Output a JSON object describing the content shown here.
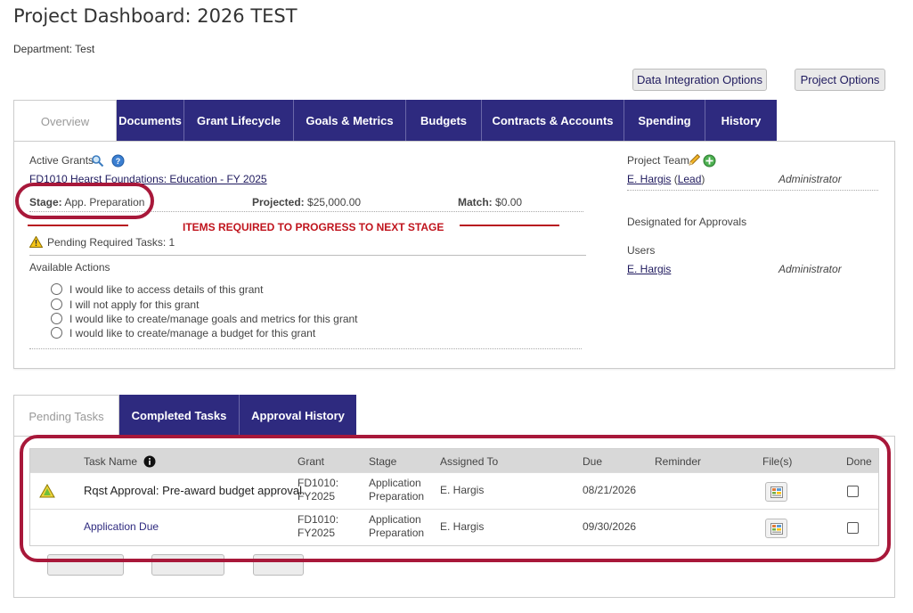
{
  "header": {
    "title": "Project Dashboard: 2026 TEST",
    "department": "Department: Test",
    "data_integration_label": "Data Integration Options",
    "project_options_label": "Project Options"
  },
  "main_tabs": [
    {
      "label": "Overview",
      "active": true
    },
    {
      "label": "Documents"
    },
    {
      "label": "Grant Lifecycle"
    },
    {
      "label": "Goals & Metrics"
    },
    {
      "label": "Budgets"
    },
    {
      "label": "Contracts & Accounts"
    },
    {
      "label": "Spending"
    },
    {
      "label": "History"
    }
  ],
  "overview": {
    "active_grants_label": "Active Grants",
    "grant_name": "FD1010 Hearst Foundations: Education - FY 2025",
    "stage_label": "Stage:",
    "stage_value": "App. Preparation",
    "projected_label": "Projected:",
    "projected_value": "$25,000.00",
    "match_label": "Match:",
    "match_value": "$0.00",
    "required_heading": "ITEMS REQUIRED TO PROGRESS TO NEXT STAGE",
    "pending_tasks": "Pending Required Tasks: 1",
    "available_actions_label": "Available Actions",
    "actions": [
      "I would like to access details of this grant",
      "I will not apply for this grant",
      "I would like to create/manage goals and metrics for this grant",
      "I would like to create/manage a budget for this grant"
    ],
    "team": {
      "label": "Project Team",
      "lead_name": "E. Hargis",
      "lead_tag": "Lead",
      "lead_role": "Administrator",
      "designated_label": "Designated for Approvals",
      "users_label": "Users",
      "user_name": "E. Hargis",
      "user_role": "Administrator"
    }
  },
  "task_tabs": [
    {
      "label": "Pending Tasks",
      "active": true
    },
    {
      "label": "Completed Tasks"
    },
    {
      "label": "Approval History"
    }
  ],
  "tasks_table": {
    "columns": [
      "Task Name",
      "Grant",
      "Stage",
      "Assigned To",
      "Due",
      "Reminder",
      "File(s)",
      "Done"
    ],
    "rows": [
      {
        "task_name": "Rqst Approval: Pre-award budget approval.",
        "grant_line1": "FD1010:",
        "grant_line2": "FY2025",
        "stage_line1": "Application",
        "stage_line2": "Preparation",
        "assigned_to": "E. Hargis",
        "due": "08/21/2026",
        "reminder": ""
      },
      {
        "task_name": "Application Due",
        "grant_line1": "FD1010:",
        "grant_line2": "FY2025",
        "stage_line1": "Application",
        "stage_line2": "Preparation",
        "assigned_to": "E. Hargis",
        "due": "09/30/2026",
        "reminder": ""
      }
    ]
  },
  "colors": {
    "tab_bg": "#2e2a7f",
    "annotation_red": "#a8183a",
    "heading_red": "#c0141d"
  }
}
